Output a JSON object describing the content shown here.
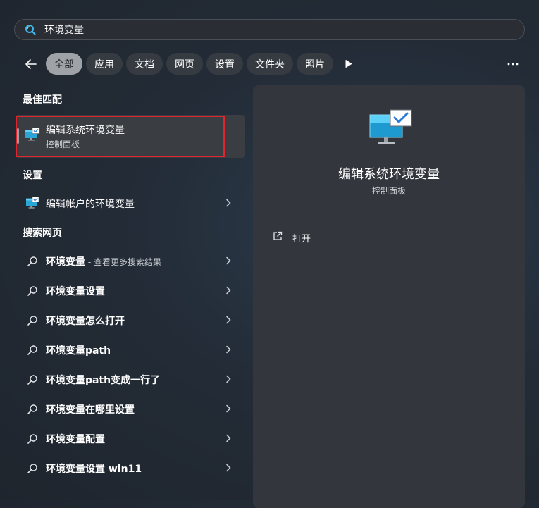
{
  "search": {
    "value": "环境变量",
    "icon": "search-icon"
  },
  "filters": {
    "back_icon": "back-arrow-icon",
    "chips": [
      "全部",
      "应用",
      "文档",
      "网页",
      "设置",
      "文件夹",
      "照片"
    ],
    "active_index": 0,
    "more_icon": "play-icon",
    "overflow_icon": "more-options-icon"
  },
  "sections": {
    "best_match": "最佳匹配",
    "settings": "设置",
    "web": "搜索网页"
  },
  "best_match": {
    "title": "编辑系统环境变量",
    "subtitle": "控制面板",
    "icon": "monitor-check-icon"
  },
  "settings_items": [
    {
      "label": "编辑帐户的环境变量",
      "icon": "monitor-check-icon"
    }
  ],
  "web_items": [
    {
      "bold": "环境变量",
      "suffix": " - 查看更多搜索结果"
    },
    {
      "bold": "环境变量设置",
      "suffix": ""
    },
    {
      "bold": "环境变量怎么打开",
      "suffix": ""
    },
    {
      "bold": "环境变量path",
      "suffix": ""
    },
    {
      "bold": "环境变量path变成一行了",
      "suffix": ""
    },
    {
      "bold": "环境变量在哪里设置",
      "suffix": ""
    },
    {
      "bold": "环境变量配置",
      "suffix": ""
    },
    {
      "bold": "环境变量设置 win11",
      "suffix": ""
    }
  ],
  "preview": {
    "title": "编辑系统环境变量",
    "subtitle": "控制面板",
    "action_label": "打开",
    "action_icon": "open-external-icon"
  },
  "colors": {
    "highlight_border": "#e0262c",
    "active_chip": "#9fa3a8",
    "chip": "#363b42",
    "panel": "#33373d"
  }
}
